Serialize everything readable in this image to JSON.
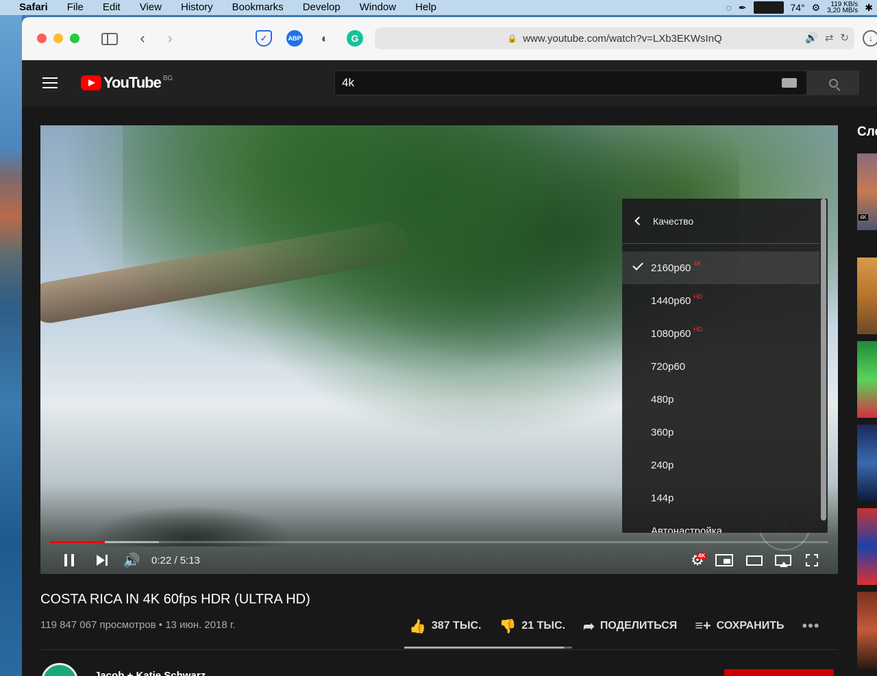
{
  "menubar": {
    "app": "Safari",
    "items": [
      "File",
      "Edit",
      "View",
      "History",
      "Bookmarks",
      "Develop",
      "Window",
      "Help"
    ],
    "temperature": "74°",
    "net_up": "119 KB/s",
    "net_down": "3,20 MB/s"
  },
  "browser": {
    "url": "www.youtube.com/watch?v=LXb3EKWsInQ",
    "extensions": [
      "shield-icon",
      "abp-icon",
      "privacy-icon",
      "grammarly-icon"
    ],
    "abp_label": "ABP",
    "grammarly_label": "G"
  },
  "youtube": {
    "logo_text": "YouTube",
    "region": "BG",
    "search_value": "4k",
    "up_next_label": "Сле",
    "thumb_badge": "4K"
  },
  "player": {
    "time_display": "0:22 / 5:13",
    "progress_played_fraction": 0.0703,
    "progress_buffered_fraction": 0.14,
    "settings_badge": "4K"
  },
  "quality_menu": {
    "title": "Качество",
    "items": [
      {
        "label": "2160p60",
        "badge": "4K",
        "selected": true
      },
      {
        "label": "1440p60",
        "badge": "HD",
        "selected": false
      },
      {
        "label": "1080p60",
        "badge": "HD",
        "selected": false
      },
      {
        "label": "720p60",
        "badge": "",
        "selected": false
      },
      {
        "label": "480p",
        "badge": "",
        "selected": false
      },
      {
        "label": "360p",
        "badge": "",
        "selected": false
      },
      {
        "label": "240p",
        "badge": "",
        "selected": false
      },
      {
        "label": "144p",
        "badge": "",
        "selected": false
      },
      {
        "label": "Автонастройка",
        "badge": "",
        "selected": false
      }
    ]
  },
  "video": {
    "title": "COSTA RICA IN 4K 60fps HDR (ULTRA HD)",
    "meta": "119 847 067 просмотров • 13 июн. 2018 г.",
    "likes": "387 ТЫС.",
    "dislikes": "21 ТЫС.",
    "share": "ПОДЕЛИТЬСЯ",
    "save": "СОХРАНИТЬ",
    "like_ratio": 0.95,
    "channel": "Jacob + Katie Schwarz"
  },
  "colors": {
    "accent": "#ff0000",
    "badge_red": "#ff3030"
  }
}
